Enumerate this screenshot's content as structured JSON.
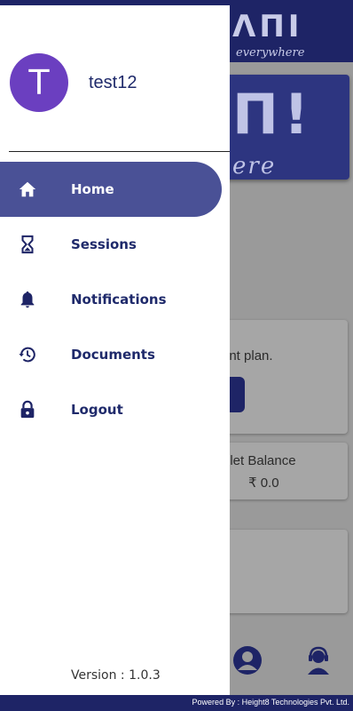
{
  "drawer": {
    "avatar_initial": "T",
    "username": "test12",
    "menu": [
      {
        "label": "Home",
        "icon": "home-icon",
        "active": true
      },
      {
        "label": "Sessions",
        "icon": "hourglass-icon",
        "active": false
      },
      {
        "label": "Notifications",
        "icon": "bell-icon",
        "active": false
      },
      {
        "label": "Documents",
        "icon": "history-icon",
        "active": false
      },
      {
        "label": "Logout",
        "icon": "lock-icon",
        "active": false
      }
    ],
    "version_label": "Version  : 1.0.3"
  },
  "background": {
    "plan_text_fragment": "ent plan.",
    "wallet_label_fragment": "llet Balance",
    "wallet_value": "₹ 0.0",
    "logo_sub_fragment": "everywhere",
    "banner_sub_fragment": "ere"
  },
  "footer": {
    "text": "Powered By : Height8 Technologies Pvt. Ltd."
  },
  "colors": {
    "brand_navy": "#1e2466",
    "active_item": "#4a5196",
    "avatar_bg": "#6b3fc0",
    "menu_text": "#1f2a6b"
  }
}
